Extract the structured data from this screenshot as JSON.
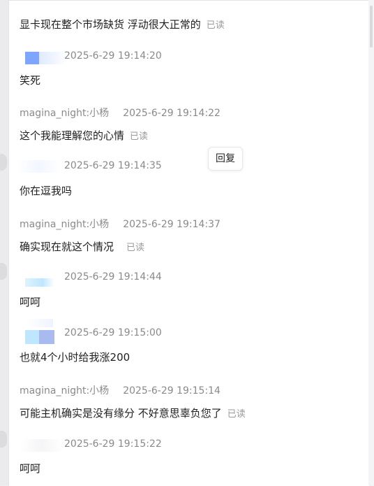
{
  "messages": [
    {
      "text": "显卡现在整个市场缺货  浮动很大正常的",
      "read": "已读"
    },
    {
      "time": "2025-6-29 19:14:20",
      "text": "笑死"
    },
    {
      "sender": "magina_night:小杨",
      "time": "2025-6-29 19:14:22",
      "text": "这个我能理解您的心情",
      "read": "已读"
    },
    {
      "time": "2025-6-29 19:14:35",
      "text": "你在逗我吗"
    },
    {
      "sender": "magina_night:小杨",
      "time": "2025-6-29 19:14:37",
      "text": "确实现在就这个情况",
      "read": "已读"
    },
    {
      "time": "2025-6-29 19:14:44",
      "text": "呵呵"
    },
    {
      "time": "2025-6-29 19:15:00",
      "text": "也就4个小时给我涨200"
    },
    {
      "sender": "magina_night:小杨",
      "time": "2025-6-29 19:15:14",
      "text": "可能主机确实是没有缘分 不好意思辜负您了",
      "read": "已读"
    },
    {
      "time": "2025-6-29 19:15:22",
      "text": "呵呵"
    }
  ],
  "reply_button": "回复"
}
